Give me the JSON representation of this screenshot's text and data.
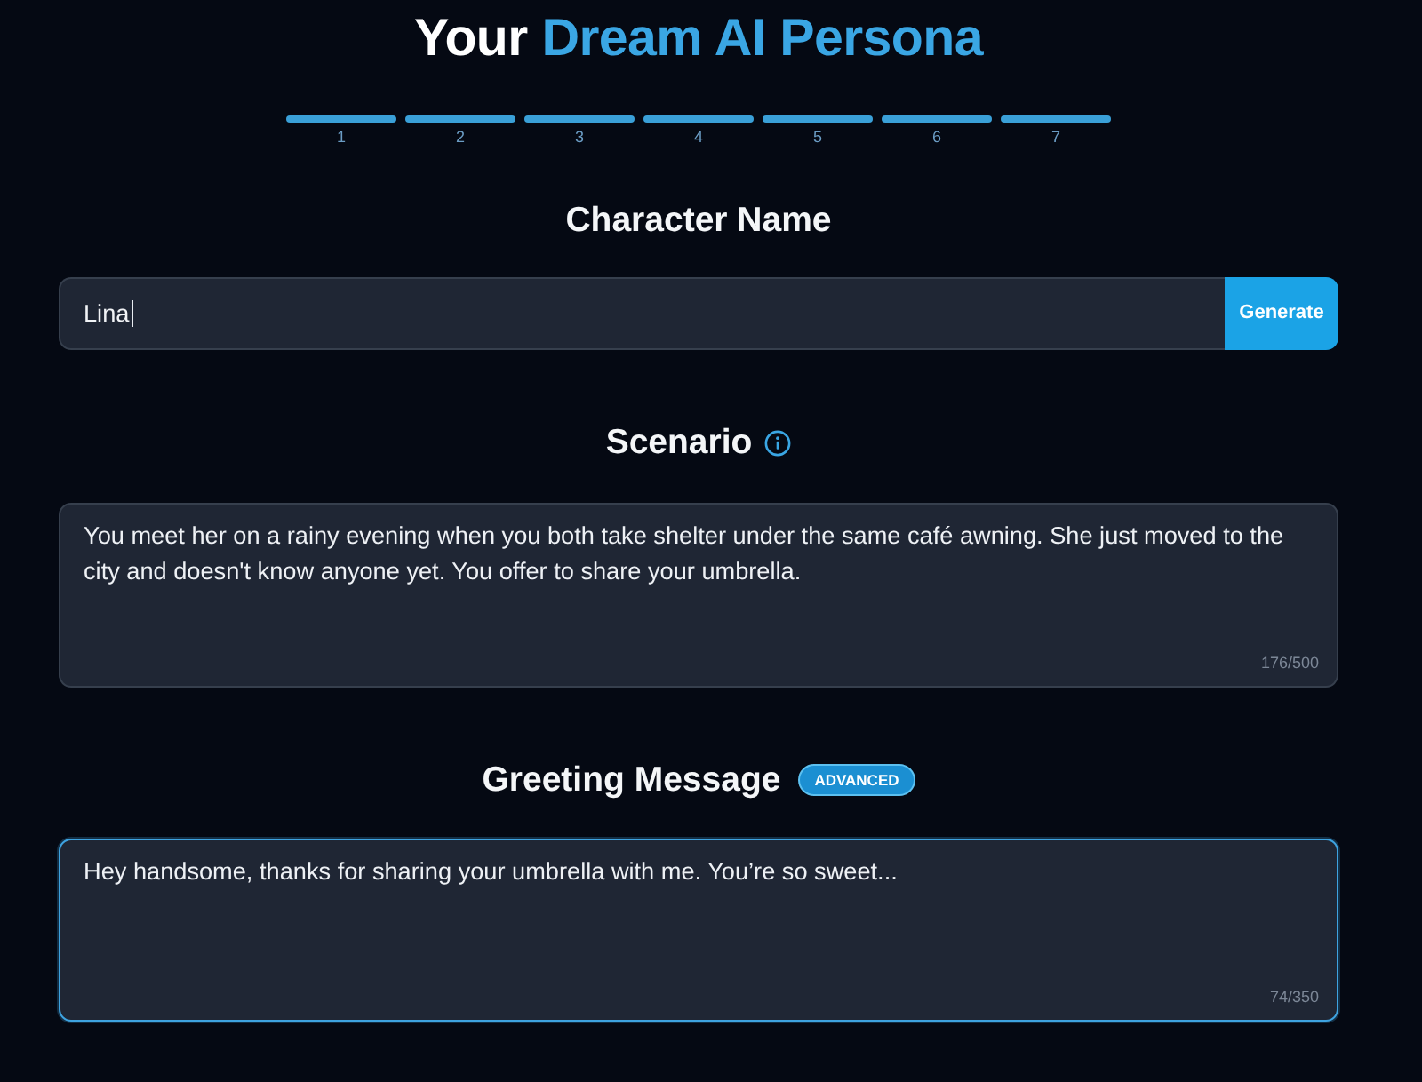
{
  "title": {
    "text": "Your",
    "accent": "Dream AI Persona"
  },
  "steps": [
    {
      "label": "1",
      "completed": true
    },
    {
      "label": "2",
      "completed": true
    },
    {
      "label": "3",
      "completed": true
    },
    {
      "label": "4",
      "completed": true
    },
    {
      "label": "5",
      "completed": true
    },
    {
      "label": "6",
      "completed": true
    },
    {
      "label": "7",
      "completed": true
    }
  ],
  "sections": [
    {
      "kind": "name",
      "heading": "Character Name",
      "info": false,
      "field": {
        "value": "Lina",
        "caret": true,
        "highlighted": false
      },
      "button": "Generate"
    },
    {
      "kind": "textarea",
      "heading": "Scenario",
      "info": true,
      "field": {
        "value": "You meet her on a rainy evening when you both take shelter under the same café awning. She just moved to the city and doesn't know anyone yet. You offer to share your umbrella.",
        "counter": "176/500",
        "caret": false,
        "highlighted": false
      }
    },
    {
      "kind": "textarea",
      "heading": "Greeting Message",
      "info": false,
      "badge": "ADVANCED",
      "field": {
        "value": "Hey handsome, thanks for sharing your umbrella with me. You’re so sweet...",
        "counter": "74/350",
        "caret": false,
        "highlighted": true
      }
    }
  ]
}
